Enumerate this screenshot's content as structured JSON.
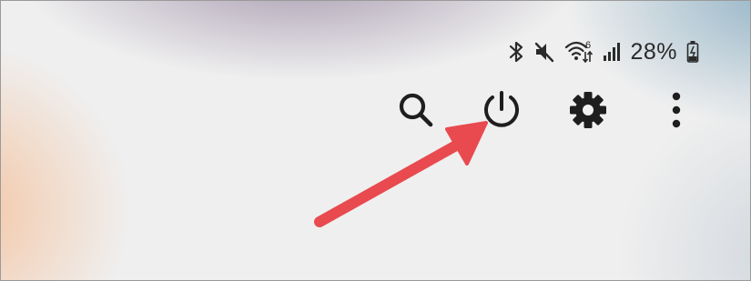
{
  "status_bar": {
    "icons": [
      "bluetooth-icon",
      "mute-icon",
      "wifi-icon",
      "signal-icon"
    ],
    "wifi_badge": "6",
    "battery_text": "28%",
    "battery_icon": "battery-charging-icon"
  },
  "toolbar": {
    "buttons": [
      {
        "icon": "search-icon"
      },
      {
        "icon": "power-icon"
      },
      {
        "icon": "gear-icon"
      },
      {
        "icon": "more-vertical-icon"
      }
    ]
  },
  "annotation": {
    "arrow_color": "#e84a4f",
    "target": "power-icon"
  }
}
